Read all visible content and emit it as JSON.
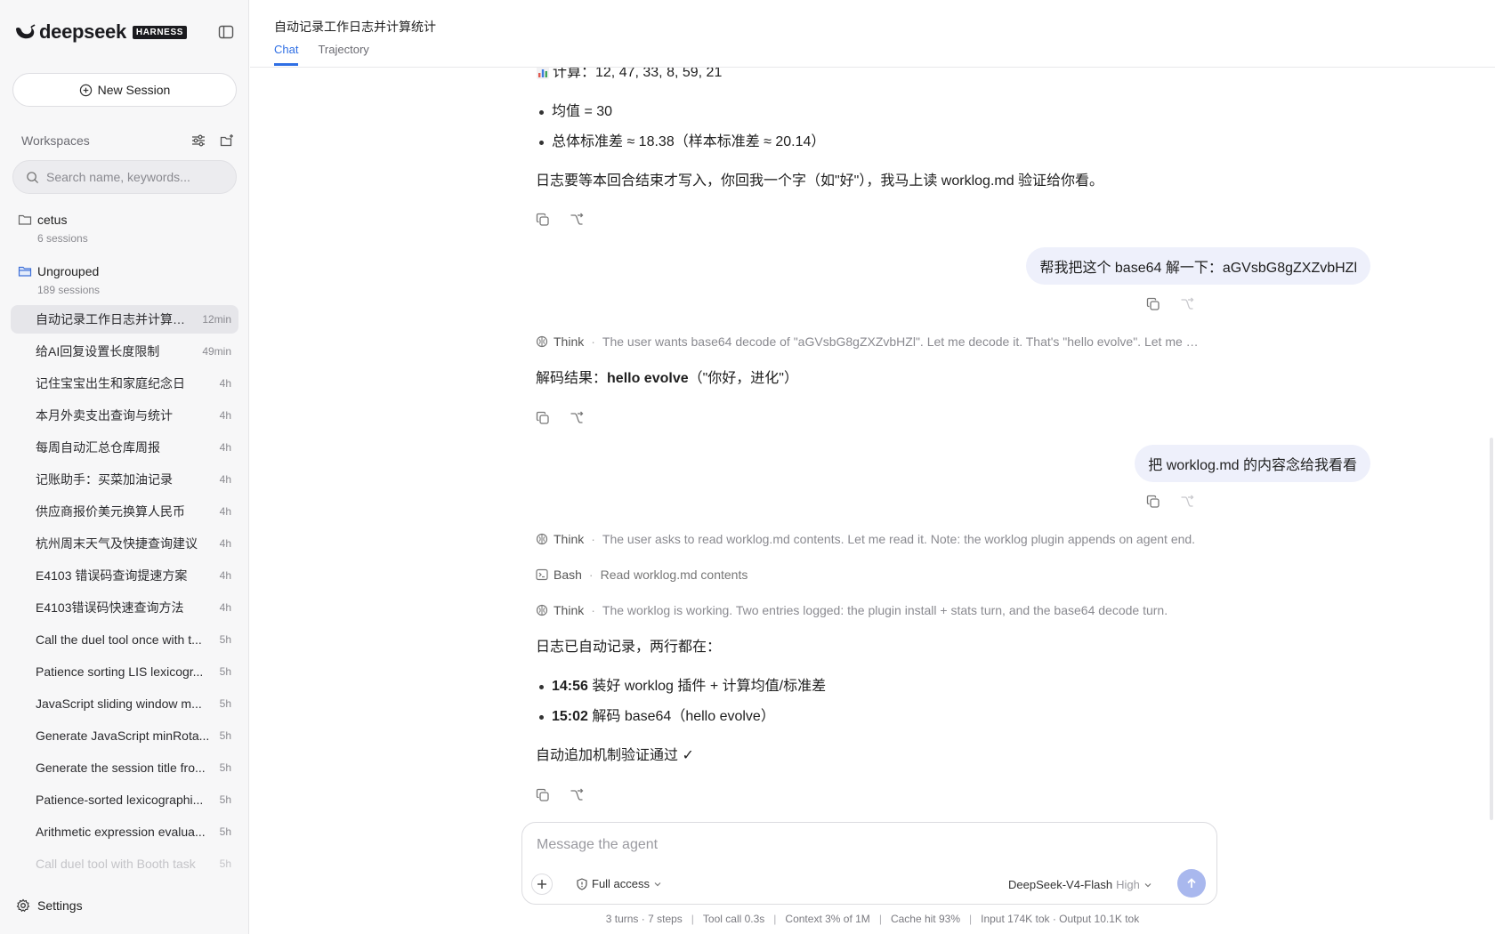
{
  "app": {
    "brand": "deepseek",
    "badge": "HARNESS"
  },
  "sidebar": {
    "new_session": "New Session",
    "workspaces_label": "Workspaces",
    "search_placeholder": "Search name, keywords...",
    "groups": [
      {
        "name": "cetus",
        "count": "6 sessions"
      },
      {
        "name": "Ungrouped",
        "count": "189 sessions"
      }
    ],
    "sessions": [
      {
        "title": "自动记录工作日志并计算统计",
        "time": "12min"
      },
      {
        "title": "给AI回复设置长度限制",
        "time": "49min"
      },
      {
        "title": "记住宝宝出生和家庭纪念日",
        "time": "4h"
      },
      {
        "title": "本月外卖支出查询与统计",
        "time": "4h"
      },
      {
        "title": "每周自动汇总仓库周报",
        "time": "4h"
      },
      {
        "title": "记账助手：买菜加油记录",
        "time": "4h"
      },
      {
        "title": "供应商报价美元换算人民币",
        "time": "4h"
      },
      {
        "title": "杭州周末天气及快捷查询建议",
        "time": "4h"
      },
      {
        "title": "E4103 错误码查询提速方案",
        "time": "4h"
      },
      {
        "title": "E4103错误码快速查询方法",
        "time": "4h"
      },
      {
        "title": "Call the duel tool once with t...",
        "time": "5h"
      },
      {
        "title": "Patience sorting LIS lexicogr...",
        "time": "5h"
      },
      {
        "title": "JavaScript sliding window m...",
        "time": "5h"
      },
      {
        "title": "Generate JavaScript minRota...",
        "time": "5h"
      },
      {
        "title": "Generate the session title fro...",
        "time": "5h"
      },
      {
        "title": "Patience-sorted lexicographi...",
        "time": "5h"
      },
      {
        "title": "Arithmetic expression evalua...",
        "time": "5h"
      },
      {
        "title": "Call duel tool with Booth task",
        "time": "5h"
      }
    ],
    "settings": "Settings"
  },
  "header": {
    "title": "自动记录工作日志并计算统计",
    "tabs": [
      "Chat",
      "Trajectory"
    ]
  },
  "chat": {
    "calc_line": "计算：12, 47, 33, 8, 59, 21",
    "stat_bullets": [
      "均值 = 30",
      "总体标准差 ≈ 18.38（样本标准差 ≈ 20.14）"
    ],
    "log_note": "日志要等本回合结束才写入，你回我一个字（如\"好\"），我马上读 worklog.md 验证给你看。",
    "user_msg_1": "帮我把这个 base64 解一下：aGVsbG8gZXZvbHZl",
    "think_1": {
      "kind": "Think",
      "text": "The user wants base64 decode of \"aGVsbG8gZXZvbHZl\". Let me decode it. That's \"hello evolve\". Let me double-check the decoding before answering."
    },
    "decode_prefix": "解码结果：",
    "decode_bold": "hello evolve",
    "decode_suffix": "（\"你好，进化\"）",
    "user_msg_2": "把 worklog.md 的内容念给我看看",
    "think_2": {
      "kind": "Think",
      "text": "The user asks to read worklog.md contents. Let me read it. Note: the worklog plugin appends on agent end."
    },
    "bash_step": {
      "kind": "Bash",
      "text": "Read worklog.md contents"
    },
    "think_3": {
      "kind": "Think",
      "text": "The worklog is working. Two entries logged: the plugin install + stats turn, and the base64 decode turn."
    },
    "log_intro": "日志已自动记录，两行都在：",
    "log_entries": [
      {
        "time": "14:56",
        "text": "装好 worklog 插件 + 计算均值/标准差"
      },
      {
        "time": "15:02",
        "text": "解码 base64（hello evolve）"
      }
    ],
    "verify": "自动追加机制验证通过 ✓"
  },
  "composer": {
    "placeholder": "Message the agent",
    "access": "Full access",
    "model": "DeepSeek-V4-Flash",
    "level": "High"
  },
  "status": {
    "turns": "3 turns · 7 steps",
    "tool_call": "Tool call 0.3s",
    "context": "Context 3% of 1M",
    "cache": "Cache hit 93%",
    "tokens": "Input 174K tok · Output 10.1K tok"
  },
  "colors": {
    "accent": "#2f6fe4",
    "user_bubble": "#eef0fb",
    "send_button": "#a9b8ee",
    "sidebar_bg": "#f7f7f8"
  }
}
